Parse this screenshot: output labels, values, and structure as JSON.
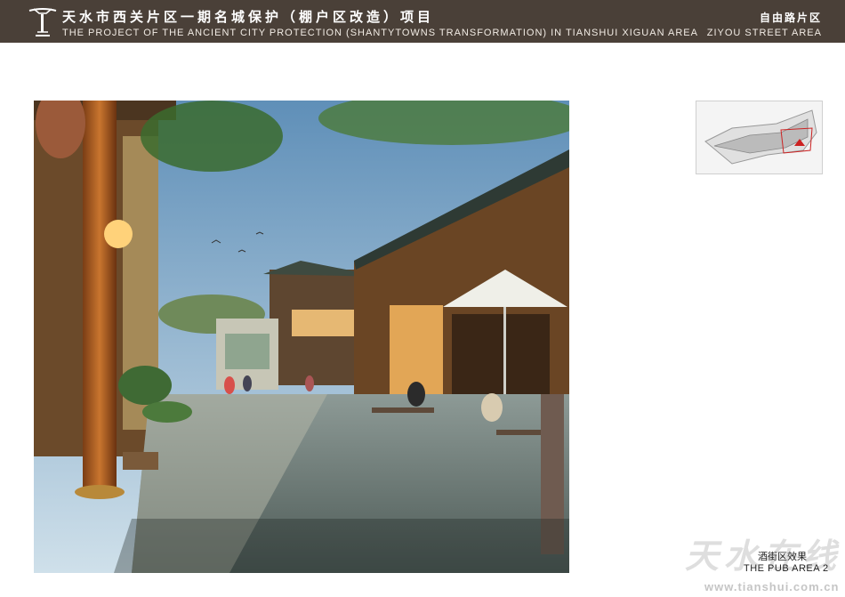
{
  "header": {
    "title_cn": "天水市西关片区一期名城保护（棚户区改造）项目",
    "title_en": "THE PROJECT OF THE ANCIENT CITY PROTECTION (SHANTYTOWNS TRANSFORMATION) IN TIANSHUI XIGUAN AREA",
    "area_cn": "自由路片区",
    "area_en": "ZIYOU STREET AREA"
  },
  "caption": {
    "cn": "酒街区效果",
    "en": "THE PUB AREA 2"
  },
  "watermark": {
    "cn": "天水在线",
    "url": "www.tianshui.com.cn"
  },
  "colors": {
    "header_bg": "#4a4038",
    "keymap_highlight": "#cc2222"
  }
}
